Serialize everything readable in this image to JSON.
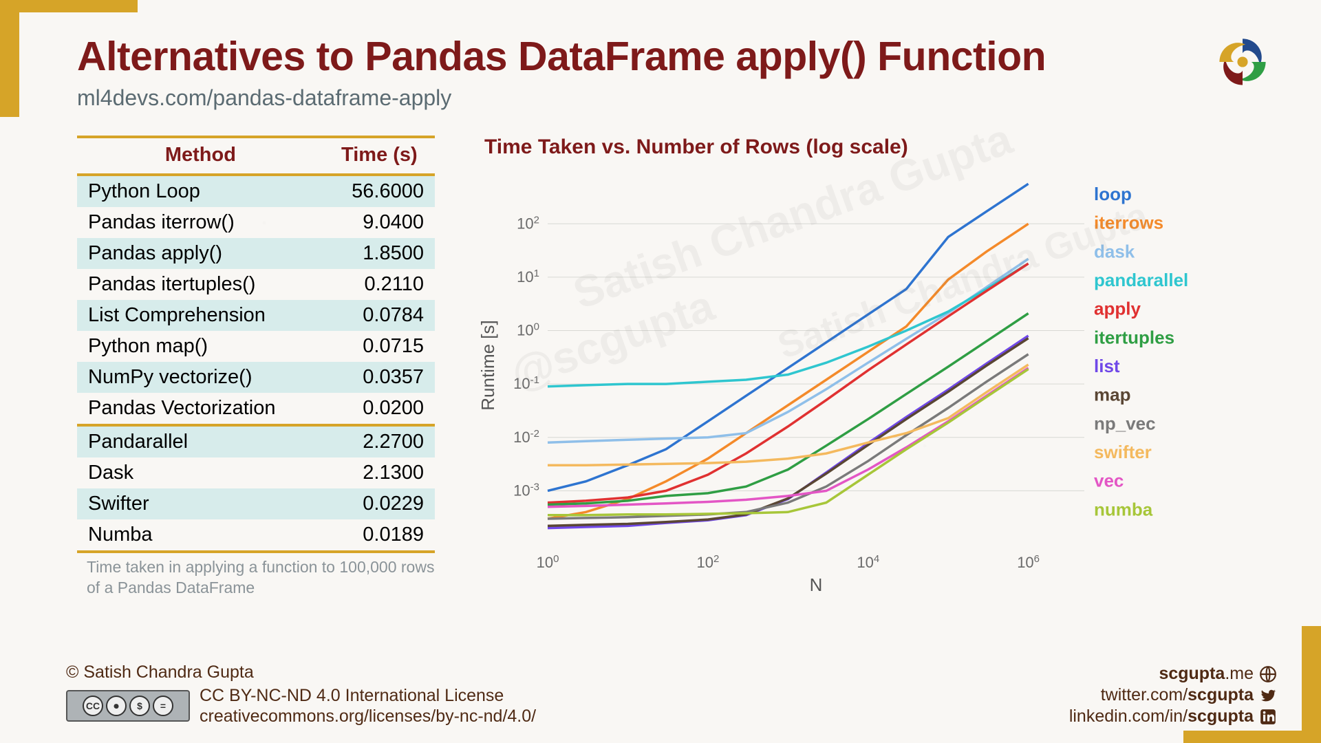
{
  "header": {
    "title": "Alternatives to Pandas DataFrame apply() Function",
    "subtitle": "ml4devs.com/pandas-dataframe-apply"
  },
  "table": {
    "columns": [
      "Method",
      "Time (s)"
    ],
    "rows": [
      {
        "method": "Python Loop",
        "time": "56.6000"
      },
      {
        "method": "Pandas iterrow()",
        "time": "9.0400"
      },
      {
        "method": "Pandas apply()",
        "time": "1.8500"
      },
      {
        "method": "Pandas itertuples()",
        "time": "0.2110"
      },
      {
        "method": "List Comprehension",
        "time": "0.0784"
      },
      {
        "method": "Python map()",
        "time": "0.0715"
      },
      {
        "method": "NumPy vectorize()",
        "time": "0.0357"
      },
      {
        "method": "Pandas Vectorization",
        "time": "0.0200"
      },
      {
        "method": "Pandarallel",
        "time": "2.2700"
      },
      {
        "method": "Dask",
        "time": "2.1300"
      },
      {
        "method": "Swifter",
        "time": "0.0229"
      },
      {
        "method": "Numba",
        "time": "0.0189"
      }
    ],
    "separator_after_index": 7,
    "caption": "Time taken in applying a function to 100,000 rows of a Pandas DataFrame"
  },
  "chart_data": {
    "type": "line",
    "title": "Time Taken vs. Number of Rows (log scale)",
    "xlabel": "N",
    "ylabel": "Runtime [s]",
    "x_log": true,
    "y_log": true,
    "xlim": [
      1,
      5000000
    ],
    "ylim": [
      0.0001,
      500
    ],
    "x_ticks": [
      1,
      100,
      10000,
      1000000
    ],
    "y_ticks": [
      0.001,
      0.01,
      0.1,
      1,
      10,
      100
    ],
    "x": [
      1,
      3,
      10,
      30,
      100,
      300,
      1000,
      3000,
      10000,
      30000,
      100000,
      300000,
      1000000
    ],
    "series": [
      {
        "name": "loop",
        "color": "#2e74d0",
        "values": [
          0.001,
          0.0015,
          0.003,
          0.006,
          0.02,
          0.06,
          0.2,
          0.6,
          2.0,
          6.0,
          56.6,
          170,
          560
        ]
      },
      {
        "name": "iterrows",
        "color": "#f48a2a",
        "values": [
          0.0003,
          0.0004,
          0.0007,
          0.0015,
          0.004,
          0.012,
          0.04,
          0.12,
          0.4,
          1.2,
          9.04,
          30,
          100
        ]
      },
      {
        "name": "dask",
        "color": "#8fbfe9",
        "values": [
          0.008,
          0.0085,
          0.009,
          0.0095,
          0.01,
          0.012,
          0.03,
          0.08,
          0.25,
          0.7,
          2.13,
          6.5,
          22
        ]
      },
      {
        "name": "pandarallel",
        "color": "#2fc6cf",
        "values": [
          0.09,
          0.095,
          0.1,
          0.1,
          0.11,
          0.12,
          0.15,
          0.25,
          0.5,
          1.0,
          2.27,
          6.0,
          18
        ]
      },
      {
        "name": "apply",
        "color": "#e03131",
        "values": [
          0.0006,
          0.00065,
          0.00075,
          0.001,
          0.002,
          0.005,
          0.016,
          0.05,
          0.18,
          0.55,
          1.85,
          5.5,
          18
        ]
      },
      {
        "name": "itertuples",
        "color": "#2f9e44",
        "values": [
          0.00055,
          0.00058,
          0.00065,
          0.0008,
          0.0009,
          0.0012,
          0.0025,
          0.007,
          0.022,
          0.065,
          0.211,
          0.63,
          2.1
        ]
      },
      {
        "name": "list",
        "color": "#7048e8",
        "values": [
          0.0002,
          0.00021,
          0.00022,
          0.00025,
          0.00028,
          0.00035,
          0.0007,
          0.0022,
          0.0078,
          0.024,
          0.0784,
          0.24,
          0.8
        ]
      },
      {
        "name": "map",
        "color": "#5a4634",
        "values": [
          0.00022,
          0.00023,
          0.00024,
          0.00026,
          0.00029,
          0.00036,
          0.00072,
          0.0021,
          0.0072,
          0.022,
          0.0715,
          0.22,
          0.72
        ]
      },
      {
        "name": "np_vec",
        "color": "#7a7a7a",
        "values": [
          0.0003,
          0.00031,
          0.00032,
          0.00034,
          0.00036,
          0.0004,
          0.0006,
          0.0012,
          0.0036,
          0.011,
          0.0357,
          0.11,
          0.36
        ]
      },
      {
        "name": "swifter",
        "color": "#f4b95e",
        "values": [
          0.003,
          0.003,
          0.0031,
          0.0032,
          0.0033,
          0.0035,
          0.004,
          0.005,
          0.008,
          0.012,
          0.0229,
          0.07,
          0.23
        ]
      },
      {
        "name": "vec",
        "color": "#e356c5",
        "values": [
          0.0005,
          0.00052,
          0.00055,
          0.00058,
          0.00062,
          0.00068,
          0.0008,
          0.001,
          0.0025,
          0.0065,
          0.02,
          0.06,
          0.2
        ]
      },
      {
        "name": "numba",
        "color": "#a7c639",
        "values": [
          0.00035,
          0.00035,
          0.00036,
          0.00036,
          0.00037,
          0.00038,
          0.0004,
          0.0006,
          0.002,
          0.006,
          0.0189,
          0.057,
          0.19
        ]
      }
    ],
    "watermarks": [
      "Satish Chandra Gupta",
      "@scgupta",
      "Satish Chandra Gupta"
    ]
  },
  "footer": {
    "copyright": "© Satish Chandra Gupta",
    "license_line1": "CC BY-NC-ND 4.0 International License",
    "license_line2": "creativecommons.org/licenses/by-nc-nd/4.0/",
    "links": {
      "site_prefix": "scgupta",
      "site_suffix": ".me",
      "twitter_prefix": "twitter.com/",
      "twitter_handle": "scgupta",
      "linkedin_prefix": "linkedin.com/in/",
      "linkedin_handle": "scgupta"
    }
  }
}
